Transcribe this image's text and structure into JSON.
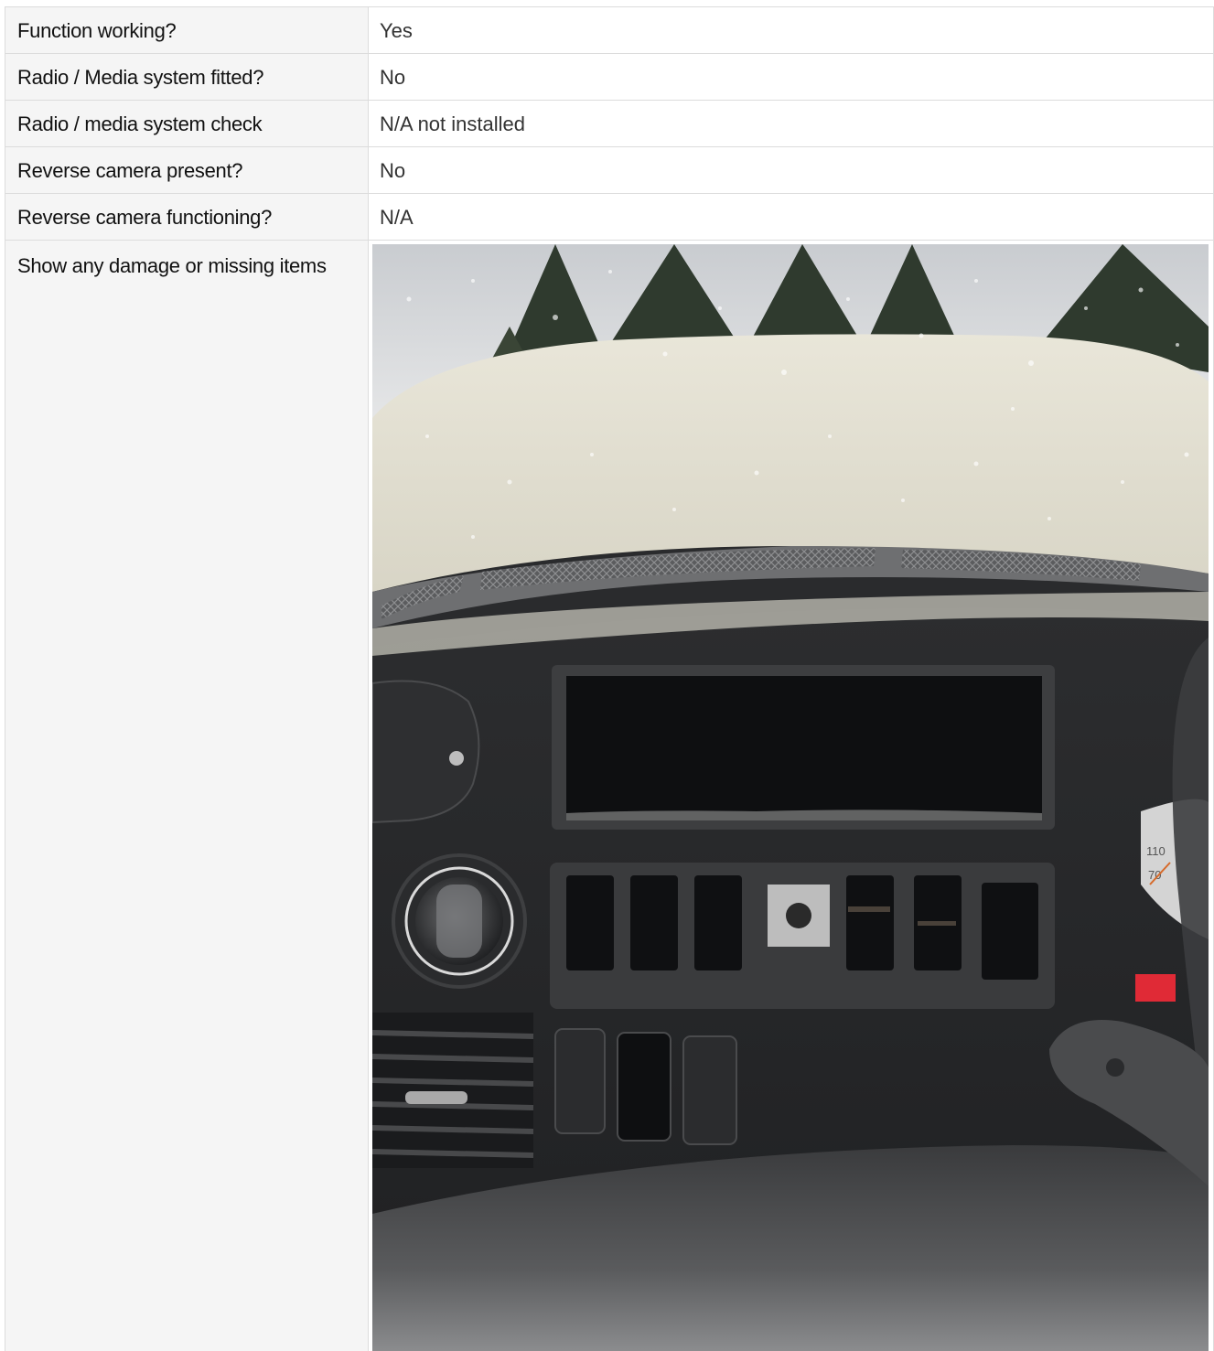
{
  "rows": [
    {
      "label": "Function working?",
      "value": "Yes"
    },
    {
      "label": "Radio / Media system fitted?",
      "value": "No"
    },
    {
      "label": "Radio / media system check",
      "value": "N/A not installed"
    },
    {
      "label": "Reverse camera present?",
      "value": "No"
    },
    {
      "label": "Reverse camera functioning?",
      "value": "N/A"
    }
  ],
  "photo_row": {
    "label": "Show any damage or missing items",
    "speedo_labels": [
      "110",
      "70"
    ]
  }
}
